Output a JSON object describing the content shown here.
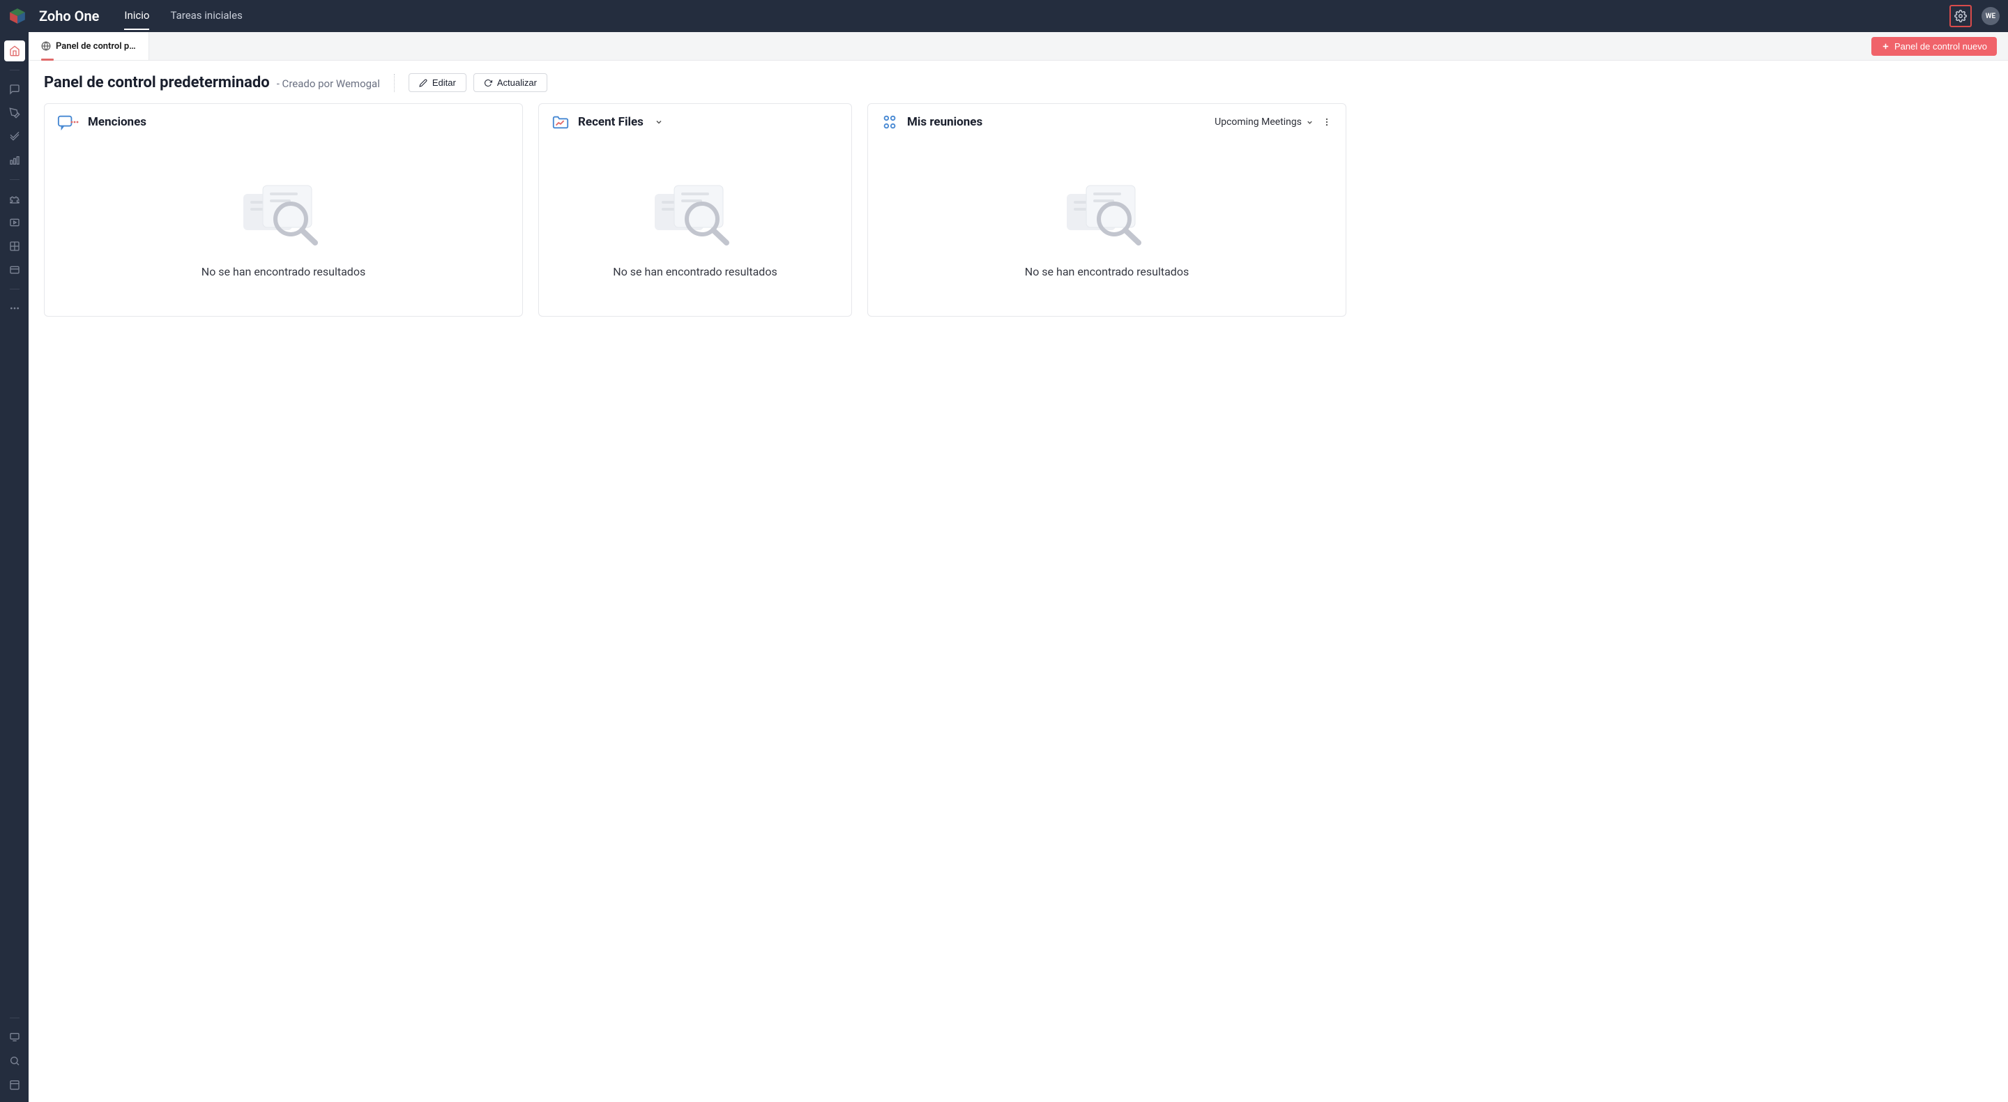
{
  "header": {
    "app_title": "Zoho One",
    "nav": [
      {
        "label": "Inicio",
        "active": true
      },
      {
        "label": "Tareas iniciales",
        "active": false
      }
    ],
    "avatar_initials": "WE"
  },
  "subheader": {
    "active_tab_label": "Panel de control p…",
    "new_button_label": "Panel de control nuevo"
  },
  "titlebar": {
    "heading": "Panel de control predeterminado",
    "byline_prefix": "- Creado por ",
    "byline_author": "Wemogal",
    "edit_label": "Editar",
    "refresh_label": "Actualizar"
  },
  "cards": {
    "mentions": {
      "title": "Menciones",
      "empty_text": "No se han encontrado resultados"
    },
    "recent_files": {
      "title": "Recent Files",
      "empty_text": "No se han encontrado resultados"
    },
    "meetings": {
      "title": "Mis reuniones",
      "filter_label": "Upcoming Meetings",
      "empty_text": "No se han encontrado resultados"
    }
  },
  "colors": {
    "accent": "#f0636a",
    "topbar": "#242d3e",
    "link_blue": "#4587d2"
  }
}
